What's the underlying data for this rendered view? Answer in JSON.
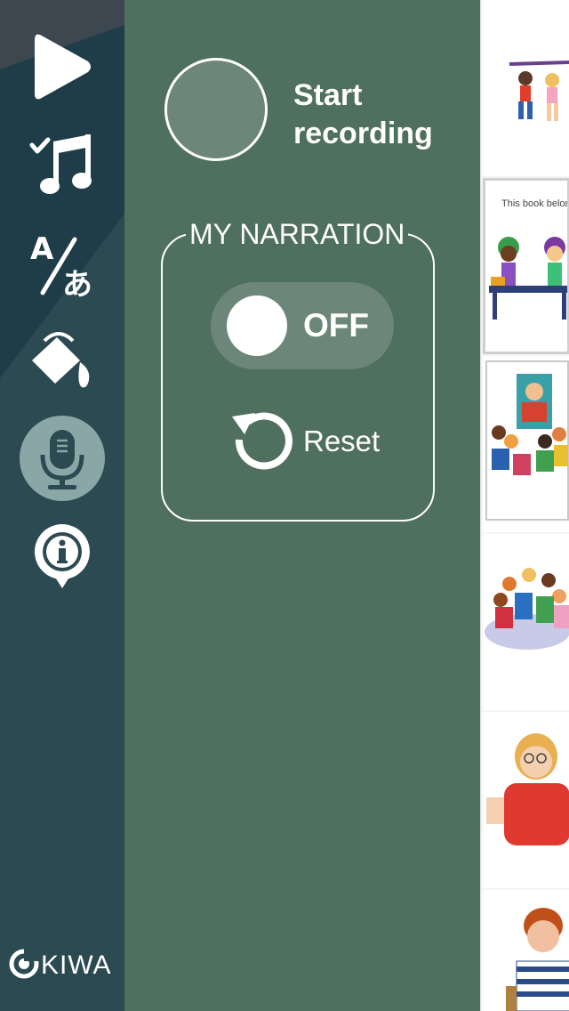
{
  "sidebar": {
    "items": [
      {
        "name": "play",
        "icon": "play-icon"
      },
      {
        "name": "music",
        "icon": "music-check-icon"
      },
      {
        "name": "language",
        "icon": "translate-icon"
      },
      {
        "name": "paint",
        "icon": "paint-bucket-icon"
      },
      {
        "name": "narration",
        "icon": "microphone-icon",
        "active": true
      },
      {
        "name": "info",
        "icon": "info-icon"
      }
    ],
    "logo_text": "KIWA"
  },
  "recording": {
    "label": "Start recording"
  },
  "narration": {
    "title": "MY NARRATION",
    "toggle_label": "OFF",
    "reset_label": "Reset"
  },
  "thumbnails": {
    "page2_text": "This book belongs t"
  },
  "colors": {
    "sidebar_bg": "#2c4a52",
    "sidebar_bg_dark": "#203a43",
    "panel_bg": "#4f6f5f",
    "panel_accent": "#6c877a",
    "active_circle": "#8aa6a7",
    "text": "#ffffff"
  }
}
